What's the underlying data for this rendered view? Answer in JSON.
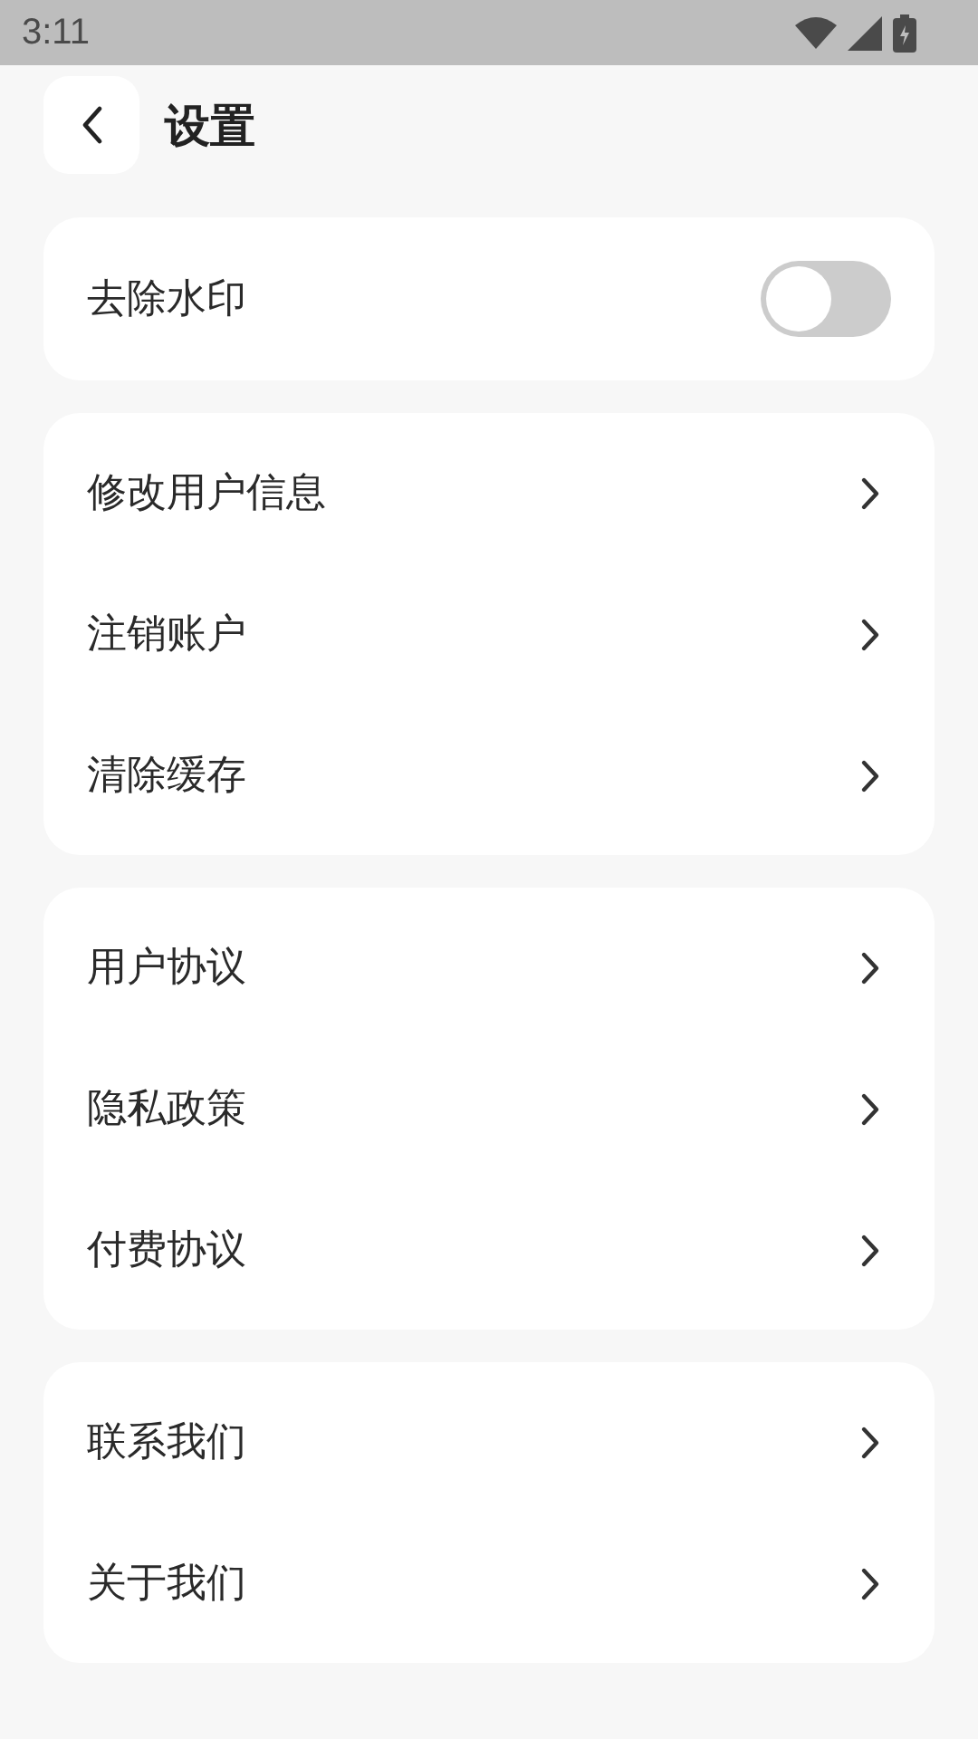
{
  "status_bar": {
    "time": "3:11"
  },
  "header": {
    "title": "设置"
  },
  "toggle_card": {
    "label": "去除水印",
    "on": false
  },
  "groups": [
    [
      {
        "label": "修改用户信息"
      },
      {
        "label": "注销账户"
      },
      {
        "label": "清除缓存"
      }
    ],
    [
      {
        "label": "用户协议"
      },
      {
        "label": "隐私政策"
      },
      {
        "label": "付费协议"
      }
    ],
    [
      {
        "label": "联系我们"
      },
      {
        "label": "关于我们"
      }
    ]
  ]
}
